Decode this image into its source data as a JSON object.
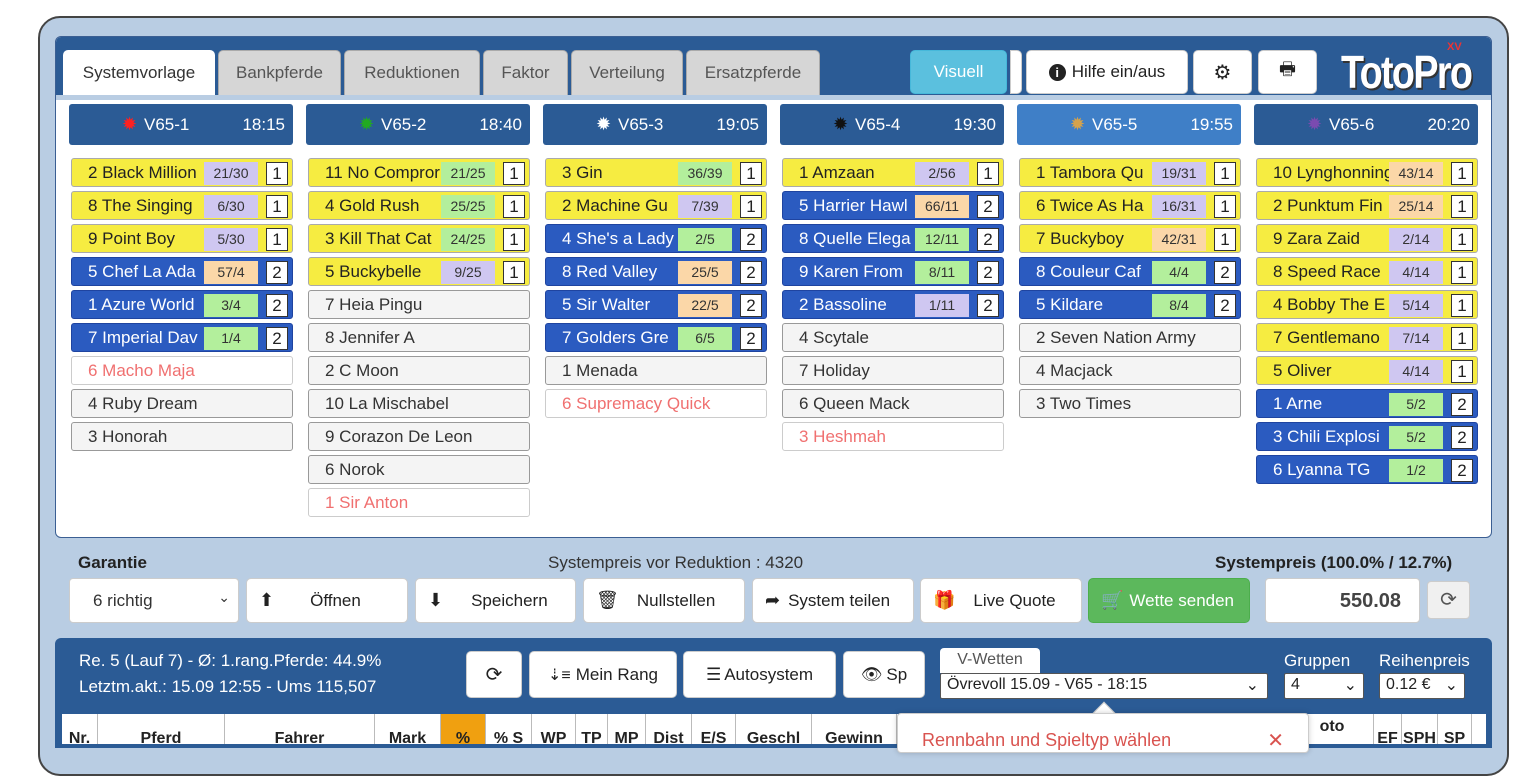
{
  "tabs": [
    "Systemvorlage",
    "Bankpferde",
    "Reduktionen",
    "Faktor",
    "Verteilung",
    "Ersatzpferde"
  ],
  "toolbar": {
    "visuell": "Visuell",
    "hilfe": "Hilfe ein/aus",
    "logo": "TotoPro",
    "logo_badge": "XV"
  },
  "races": [
    {
      "name": "V65-1",
      "time": "18:15",
      "icon_color": "#ff2020",
      "horses": [
        {
          "label": "2 Black Million",
          "odds": "21/30",
          "oc": "p",
          "rank": "1",
          "style": "y"
        },
        {
          "label": "8 The Singing",
          "odds": "6/30",
          "oc": "p",
          "rank": "1",
          "style": "y"
        },
        {
          "label": "9 Point Boy",
          "odds": "5/30",
          "oc": "p",
          "rank": "1",
          "style": "y"
        },
        {
          "label": "5 Chef La Ada",
          "odds": "57/4",
          "oc": "o",
          "rank": "2",
          "style": "b"
        },
        {
          "label": "1 Azure World",
          "odds": "3/4",
          "oc": "g",
          "rank": "2",
          "style": "b"
        },
        {
          "label": "7 Imperial Dav",
          "odds": "1/4",
          "oc": "g",
          "rank": "2",
          "style": "b"
        },
        {
          "label": "6 Macho Maja",
          "style": "r"
        },
        {
          "label": "4 Ruby Dream",
          "style": "n"
        },
        {
          "label": "3 Honorah",
          "style": "n"
        }
      ]
    },
    {
      "name": "V65-2",
      "time": "18:40",
      "icon_color": "#22aa22",
      "horses": [
        {
          "label": "11 No Compror",
          "odds": "21/25",
          "oc": "g",
          "rank": "1",
          "style": "y"
        },
        {
          "label": "4 Gold Rush",
          "odds": "25/25",
          "oc": "g",
          "rank": "1",
          "style": "y"
        },
        {
          "label": "3 Kill That Cat",
          "odds": "24/25",
          "oc": "g",
          "rank": "1",
          "style": "y"
        },
        {
          "label": "5 Buckybelle",
          "odds": "9/25",
          "oc": "p",
          "rank": "1",
          "style": "y"
        },
        {
          "label": "7 Heia Pingu",
          "style": "n"
        },
        {
          "label": "8 Jennifer A",
          "style": "n"
        },
        {
          "label": "2 C Moon",
          "style": "n"
        },
        {
          "label": "10 La Mischabel",
          "style": "n"
        },
        {
          "label": "9 Corazon De Leon",
          "style": "n"
        },
        {
          "label": "6 Norok",
          "style": "n"
        },
        {
          "label": "1 Sir Anton",
          "style": "r"
        }
      ]
    },
    {
      "name": "V65-3",
      "time": "19:05",
      "icon_color": "#ffffff",
      "horses": [
        {
          "label": "3 Gin",
          "odds": "36/39",
          "oc": "g",
          "rank": "1",
          "style": "y"
        },
        {
          "label": "2 Machine Gu",
          "odds": "7/39",
          "oc": "p",
          "rank": "1",
          "style": "y"
        },
        {
          "label": "4 She's a Lady",
          "odds": "2/5",
          "oc": "g",
          "rank": "2",
          "style": "b"
        },
        {
          "label": "8 Red Valley",
          "odds": "25/5",
          "oc": "o",
          "rank": "2",
          "style": "b"
        },
        {
          "label": "5 Sir Walter",
          "odds": "22/5",
          "oc": "o",
          "rank": "2",
          "style": "b"
        },
        {
          "label": "7 Golders Gre",
          "odds": "6/5",
          "oc": "g",
          "rank": "2",
          "style": "b"
        },
        {
          "label": "1 Menada",
          "style": "n"
        },
        {
          "label": "6 Supremacy Quick",
          "style": "r"
        }
      ]
    },
    {
      "name": "V65-4",
      "time": "19:30",
      "icon_color": "#111111",
      "horses": [
        {
          "label": "1 Amzaan",
          "odds": "2/56",
          "oc": "p",
          "rank": "1",
          "style": "y"
        },
        {
          "label": "5 Harrier Hawl",
          "odds": "66/11",
          "oc": "o",
          "rank": "2",
          "style": "b"
        },
        {
          "label": "8 Quelle Elega",
          "odds": "12/11",
          "oc": "g",
          "rank": "2",
          "style": "b"
        },
        {
          "label": "9 Karen From",
          "odds": "8/11",
          "oc": "g",
          "rank": "2",
          "style": "b"
        },
        {
          "label": "2 Bassoline",
          "odds": "1/11",
          "oc": "p",
          "rank": "2",
          "style": "b"
        },
        {
          "label": "4 Scytale",
          "style": "n"
        },
        {
          "label": "7 Holiday",
          "style": "n"
        },
        {
          "label": "6 Queen Mack",
          "style": "n"
        },
        {
          "label": "3 Heshmah",
          "style": "r"
        }
      ]
    },
    {
      "name": "V65-5",
      "time": "19:55",
      "icon_color": "#d4a24c",
      "horses": [
        {
          "label": "1 Tambora Qu",
          "odds": "19/31",
          "oc": "p",
          "rank": "1",
          "style": "y"
        },
        {
          "label": "6 Twice As Ha",
          "odds": "16/31",
          "oc": "p",
          "rank": "1",
          "style": "y"
        },
        {
          "label": "7 Buckyboy",
          "odds": "42/31",
          "oc": "o",
          "rank": "1",
          "style": "y"
        },
        {
          "label": "8 Couleur Caf",
          "odds": "4/4",
          "oc": "g",
          "rank": "2",
          "style": "b"
        },
        {
          "label": "5 Kildare",
          "odds": "8/4",
          "oc": "g",
          "rank": "2",
          "style": "b"
        },
        {
          "label": "2 Seven Nation Army",
          "style": "n"
        },
        {
          "label": "4 Macjack",
          "style": "n"
        },
        {
          "label": "3 Two Times",
          "style": "n"
        }
      ]
    },
    {
      "name": "V65-6",
      "time": "20:20",
      "icon_color": "#7b4bb0",
      "horses": [
        {
          "label": "10 Lynghonning",
          "odds": "43/14",
          "oc": "o",
          "rank": "1",
          "style": "y"
        },
        {
          "label": "2 Punktum Fin",
          "odds": "25/14",
          "oc": "o",
          "rank": "1",
          "style": "y"
        },
        {
          "label": "9 Zara Zaid",
          "odds": "2/14",
          "oc": "p",
          "rank": "1",
          "style": "y"
        },
        {
          "label": "8 Speed Race",
          "odds": "4/14",
          "oc": "p",
          "rank": "1",
          "style": "y"
        },
        {
          "label": "4 Bobby The E",
          "odds": "5/14",
          "oc": "p",
          "rank": "1",
          "style": "y"
        },
        {
          "label": "7 Gentlemano",
          "odds": "7/14",
          "oc": "p",
          "rank": "1",
          "style": "y"
        },
        {
          "label": "5 Oliver",
          "odds": "4/14",
          "oc": "p",
          "rank": "1",
          "style": "y"
        },
        {
          "label": "1 Arne",
          "odds": "5/2",
          "oc": "g",
          "rank": "2",
          "style": "b"
        },
        {
          "label": "3 Chili Explosi",
          "odds": "5/2",
          "oc": "g",
          "rank": "2",
          "style": "b"
        },
        {
          "label": "6 Lyanna TG",
          "odds": "1/2",
          "oc": "g",
          "rank": "2",
          "style": "b"
        }
      ]
    }
  ],
  "system": {
    "garantie_label": "Garantie",
    "preis_vor": "Systempreis vor Reduktion : 4320",
    "preis_label": "Systempreis (100.0% / 12.7%)",
    "garantie_value": "6 richtig",
    "preis_value": "550.08"
  },
  "actions": {
    "oeffnen": "Öffnen",
    "speichern": "Speichern",
    "nullstellen": "Nullstellen",
    "teilen": "System teilen",
    "live": "Live Quote",
    "senden": "Wette senden"
  },
  "bottom": {
    "line1": "Re. 5 (Lauf 7) - Ø: 1.rang.Pferde: 44.9%",
    "line2": "Letztm.akt.: 15.09 12:55 - Ums 115,507",
    "mein_rang": "Mein Rang",
    "autosystem": "Autosystem",
    "sp": "Sp",
    "vwetten_tab": "V-Wetten",
    "vwetten_value": "Övrevoll 15.09 - V65 - 18:15",
    "gruppen_label": "Gruppen",
    "gruppen_value": "4",
    "reihenpreis_label": "Reihenpreis",
    "reihenpreis_value": "0.12 €"
  },
  "table_headers": [
    "Nr.",
    "Pferd",
    "Fahrer",
    "Mark",
    "%",
    "% S",
    "WP",
    "TP",
    "MP",
    "Dist",
    "E/S",
    "Geschl",
    "Gewinn",
    "oto",
    "EF",
    "SPH",
    "SP"
  ],
  "toast": "Rennbahn und Spieltyp wählen"
}
